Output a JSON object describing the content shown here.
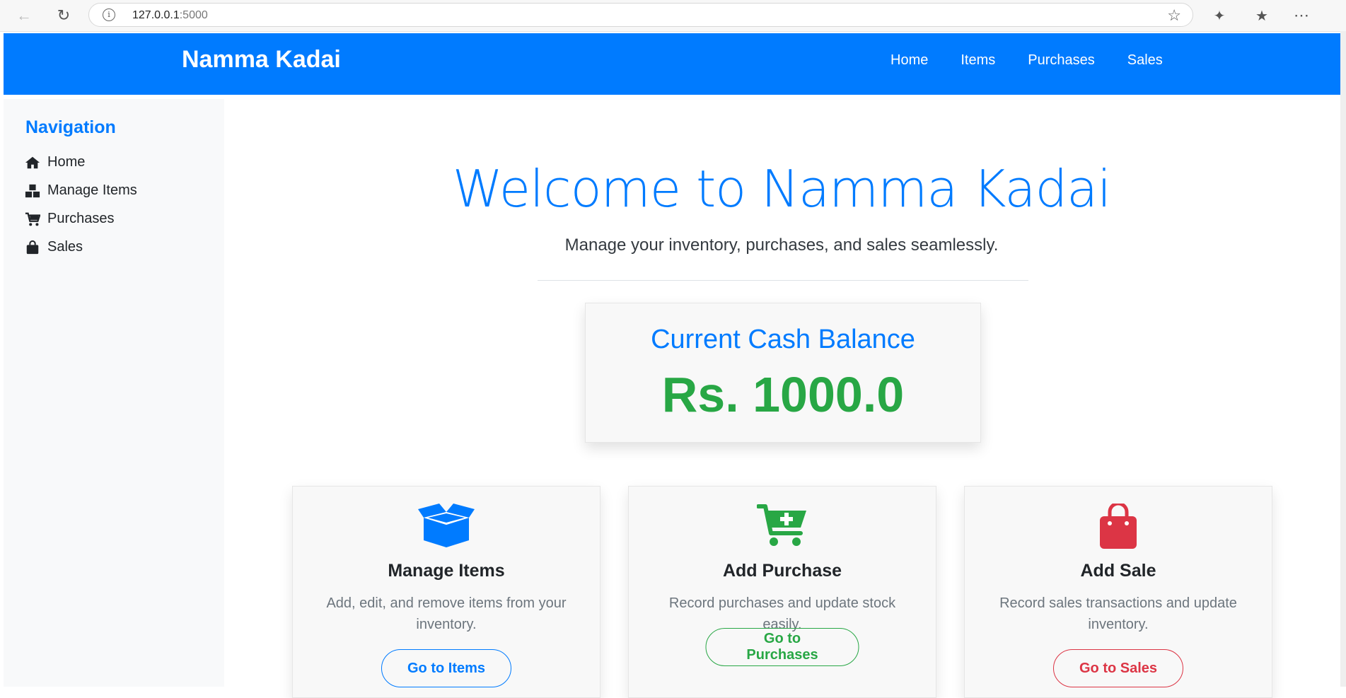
{
  "browser": {
    "url_host": "127.0.0.1",
    "url_port": ":5000"
  },
  "navbar": {
    "brand": "Namma Kadai",
    "links": [
      "Home",
      "Items",
      "Purchases",
      "Sales"
    ]
  },
  "sidebar": {
    "title": "Navigation",
    "items": [
      {
        "label": "Home",
        "icon": "home-icon"
      },
      {
        "label": "Manage Items",
        "icon": "boxes-icon"
      },
      {
        "label": "Purchases",
        "icon": "cart-icon"
      },
      {
        "label": "Sales",
        "icon": "shopping-bag-icon"
      }
    ]
  },
  "main": {
    "welcome": "Welcome to Namma Kadai",
    "lead": "Manage your inventory, purchases, and sales seamlessly.",
    "cash": {
      "title": "Current Cash Balance",
      "value": "Rs. 1000.0"
    },
    "cards": [
      {
        "title": "Manage Items",
        "desc": "Add, edit, and remove items from your inventory.",
        "button": "Go to Items",
        "icon": "open-box-icon",
        "color": "#007bff"
      },
      {
        "title": "Add Purchase",
        "desc": "Record purchases and update stock easily.",
        "button": "Go to Purchases",
        "icon": "cart-plus-icon",
        "color": "#28a745"
      },
      {
        "title": "Add Sale",
        "desc": "Record sales transactions and update inventory.",
        "button": "Go to Sales",
        "icon": "shopping-bag-icon",
        "color": "#dc3545"
      }
    ]
  }
}
